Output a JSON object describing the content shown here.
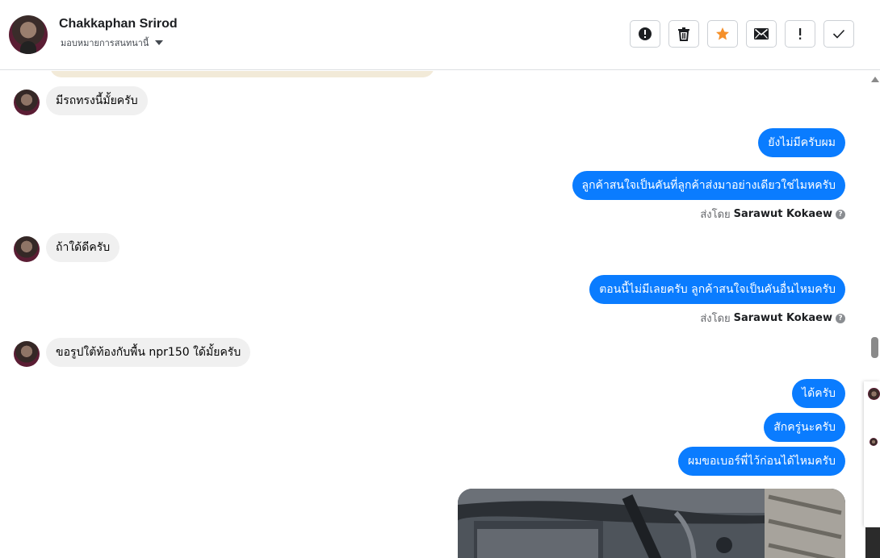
{
  "header": {
    "contact_name": "Chakkaphan Srirod",
    "assign_label": "มอบหมายการสนทนานี้",
    "toolbar": {
      "spam_icon": "alert-circle-icon",
      "delete_icon": "trash-icon",
      "star_icon": "star-icon",
      "unread_icon": "envelope-icon",
      "important_icon": "exclamation-icon",
      "done_icon": "check-icon"
    }
  },
  "colors": {
    "outgoing_bubble": "#0a7cff",
    "incoming_bubble": "#f0f0f0",
    "star": "#f5902a"
  },
  "messages": {
    "in1": "มีรถทรงนี้มั้ยครับ",
    "out1": "ยังไม่มีครับผม",
    "out2": "ลูกค้าสนใจเป็นคันที่ลูกค้าส่งมาอย่างเดียวใช่ไมหครับ",
    "in2": "ถ้าใด้ดีครับ",
    "out3": "ตอนนี้ไม่มีเลยครับ ลูกค้าสนใจเป็นคันอื่นไหมครับ",
    "in3": "ขอรูปใต้ท้องกับพื้น npr150 ใด้มั้ยครับ",
    "out4": "ได้ครับ",
    "out5": "สักครู่นะครับ",
    "out6": "ผมขอเบอร์พี่ไว้ก่อนได้ไหมครับ"
  },
  "sent_by": {
    "prefix": "ส่งโดย",
    "agent": "Sarawut Kokaew"
  }
}
